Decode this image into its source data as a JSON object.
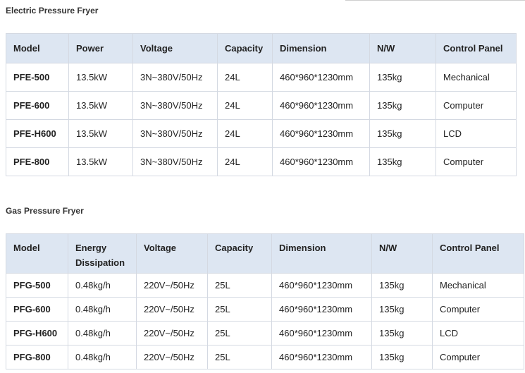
{
  "electric": {
    "title": "Electric Pressure Fryer",
    "headers": [
      "Model",
      "Power",
      "Voltage",
      "Capacity",
      "Dimension",
      "N/W",
      "Control Panel"
    ],
    "rows": [
      [
        "PFE-500",
        "13.5kW",
        "3N~380V/50Hz",
        "24L",
        "460*960*1230mm",
        "135kg",
        "Mechanical"
      ],
      [
        "PFE-600",
        "13.5kW",
        "3N~380V/50Hz",
        "24L",
        "460*960*1230mm",
        "135kg",
        "Computer"
      ],
      [
        "PFE-H600",
        "13.5kW",
        "3N~380V/50Hz",
        "24L",
        "460*960*1230mm",
        "135kg",
        "LCD"
      ],
      [
        "PFE-800",
        "13.5kW",
        "3N~380V/50Hz",
        "24L",
        "460*960*1230mm",
        "135kg",
        "Computer"
      ]
    ]
  },
  "gas": {
    "title": "Gas Pressure Fryer",
    "headers": [
      "Model",
      "Energy Dissipation",
      "Voltage",
      "Capacity",
      "Dimension",
      "N/W",
      "Control Panel"
    ],
    "rows": [
      [
        "PFG-500",
        "0.48kg/h",
        "220V~/50Hz",
        "25L",
        "460*960*1230mm",
        "135kg",
        "Mechanical"
      ],
      [
        "PFG-600",
        "0.48kg/h",
        "220V~/50Hz",
        "25L",
        "460*960*1230mm",
        "135kg",
        "Computer"
      ],
      [
        "PFG-H600",
        "0.48kg/h",
        "220V~/50Hz",
        "25L",
        "460*960*1230mm",
        "135kg",
        "LCD"
      ],
      [
        "PFG-800",
        "0.48kg/h",
        "220V~/50Hz",
        "25L",
        "460*960*1230mm",
        "135kg",
        "Computer"
      ]
    ]
  }
}
